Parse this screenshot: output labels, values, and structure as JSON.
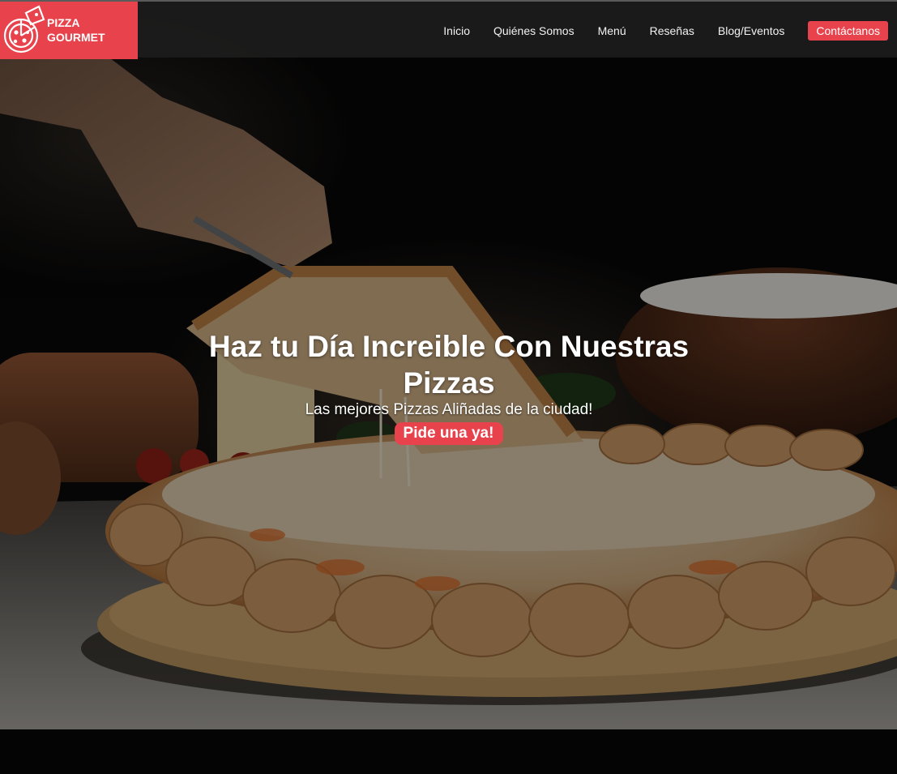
{
  "brand": {
    "line1": "PIZZA",
    "line2": "GOURMET",
    "logo_icon": "pizza-icon",
    "accent_color": "#e8434c"
  },
  "nav": {
    "items": [
      {
        "label": "Inicio"
      },
      {
        "label": "Quiénes Somos"
      },
      {
        "label": "Menú"
      },
      {
        "label": "Reseñas"
      },
      {
        "label": "Blog/Eventos"
      }
    ],
    "cta_label": "Contáctanos"
  },
  "hero": {
    "title": "Haz tu Día Increible Con Nuestras Pizzas",
    "subtitle": "Las mejores Pizzas Aliñadas de la ciudad!",
    "button_label": "Pide una ya!"
  }
}
